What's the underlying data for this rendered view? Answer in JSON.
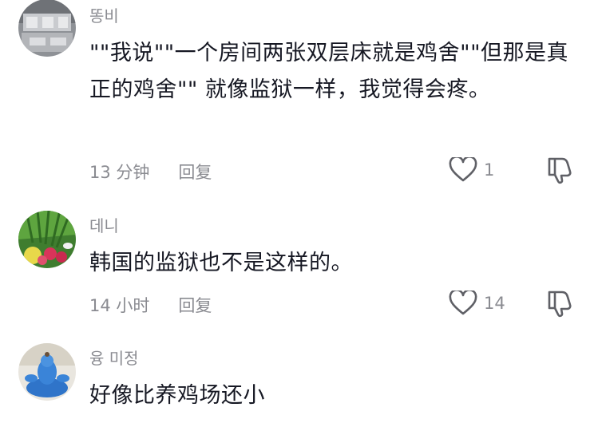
{
  "comments": [
    {
      "username": "똥비",
      "text": "\"\"我说\"\"一个房间两张双层床就是鸡舍\"\"但那是真正的鸡舍\"\"   就像监狱一样，我觉得会疼。",
      "time": "13 分钟",
      "reply_label": "回复",
      "likes": "1",
      "avatar_icon": "photo-avatar"
    },
    {
      "username": "데니",
      "text": "韩国的监狱也不是这样的。",
      "time": "14 小时",
      "reply_label": "回复",
      "likes": "14",
      "avatar_icon": "vegetables-avatar"
    },
    {
      "username": "융  미정",
      "text": "好像比养鸡场还小",
      "avatar_icon": "blue-figure-avatar"
    }
  ],
  "icons": {
    "like": "heart-outline-icon",
    "dislike": "thumbs-down-icon"
  },
  "colors": {
    "text": "#161823",
    "secondary": "#8a8b91"
  }
}
